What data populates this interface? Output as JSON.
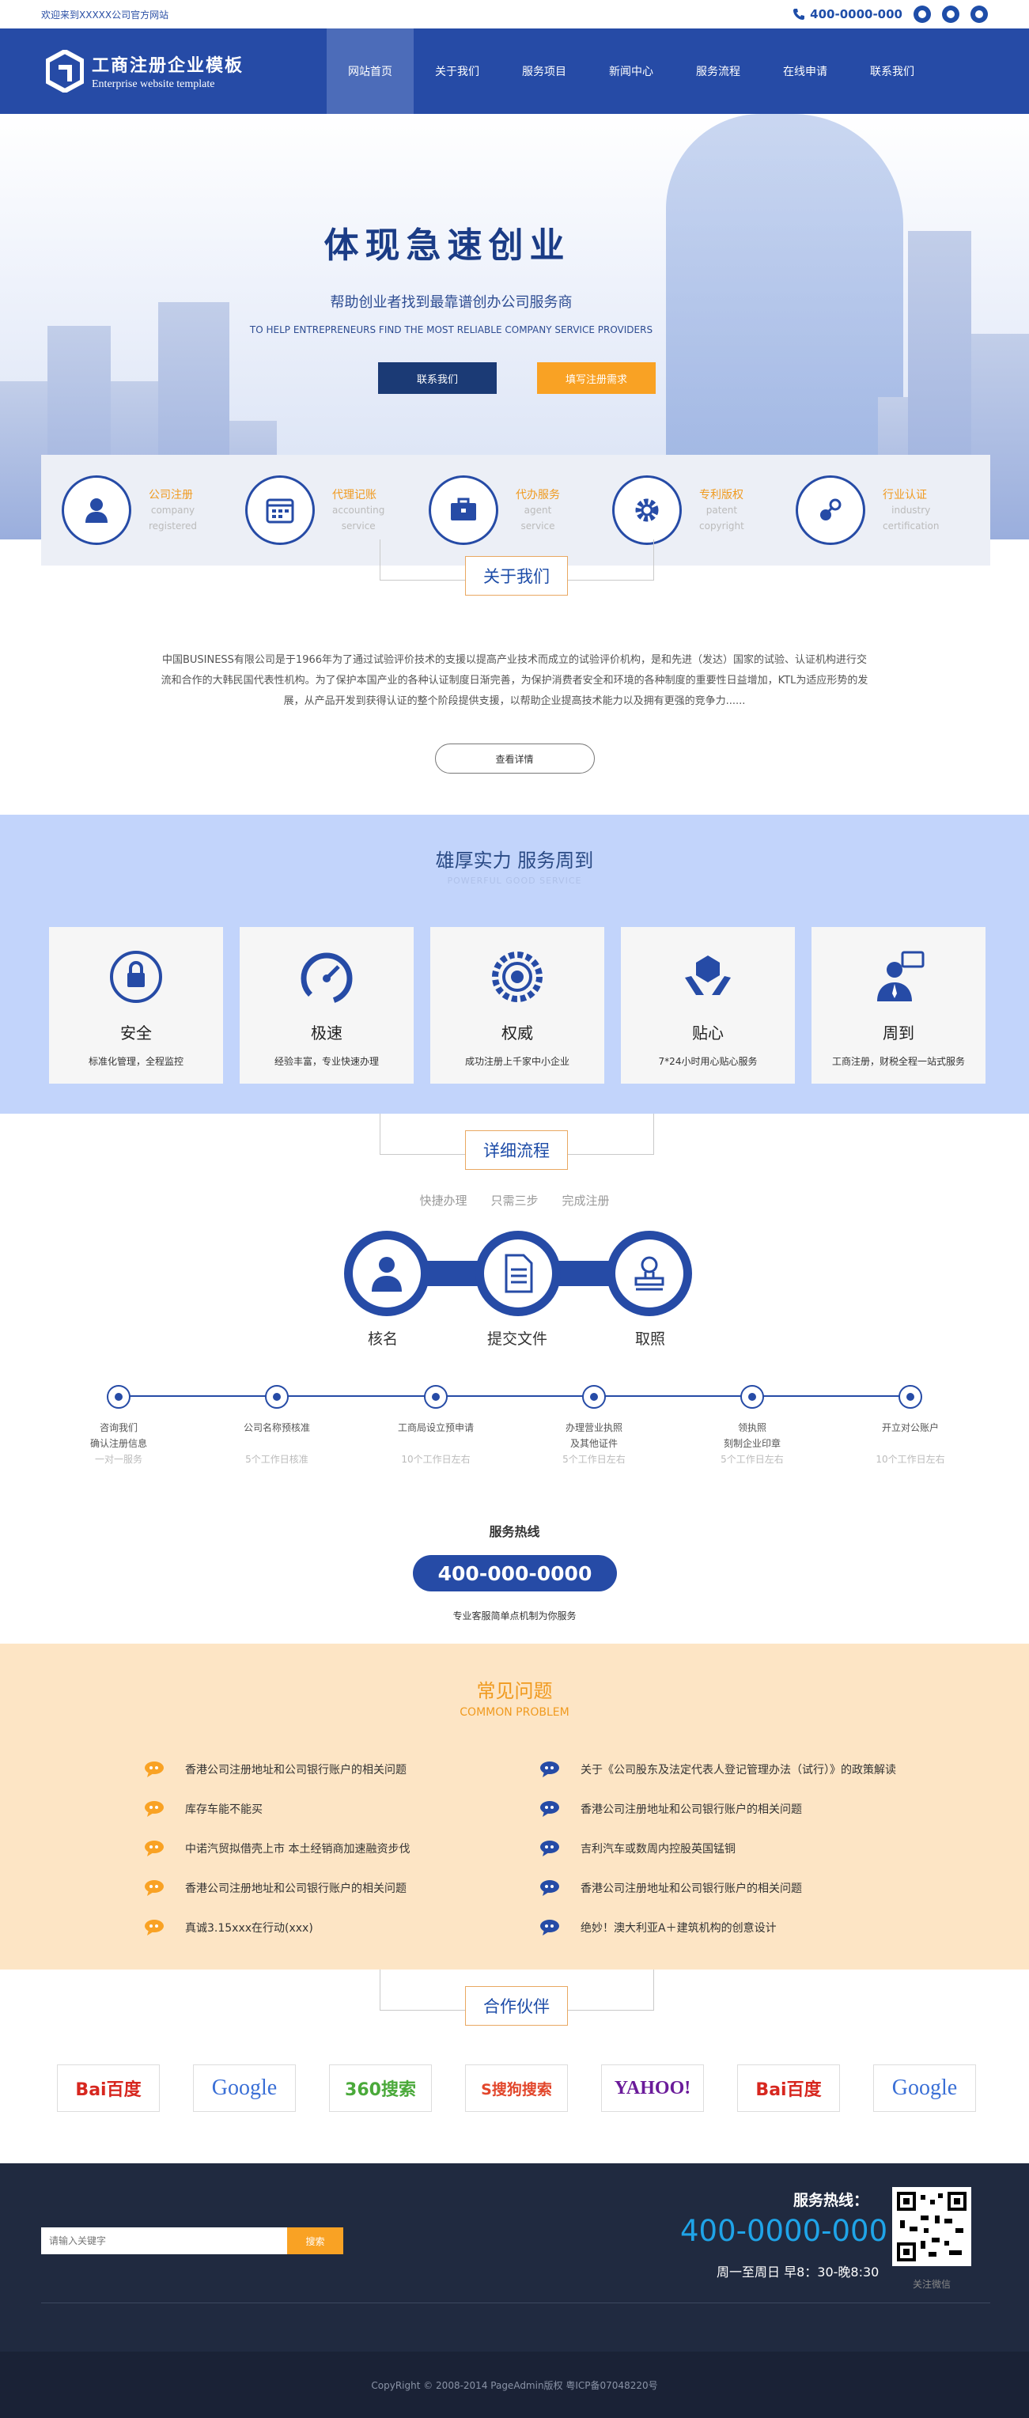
{
  "topbar": {
    "welcome": "欢迎来到XXXXX公司官方网站",
    "phone": "400-0000-000"
  },
  "header": {
    "logo_title": "工商注册企业模板",
    "logo_sub": "Enterprise website template",
    "nav": [
      "网站首页",
      "关于我们",
      "服务项目",
      "新闻中心",
      "服务流程",
      "在线申请",
      "联系我们"
    ]
  },
  "banner": {
    "title": "体现急速创业",
    "subtitle": "帮助创业者找到最靠谱创办公司服务商",
    "subtitle_en": "TO HELP ENTREPRENEURS FIND THE MOST RELIABLE COMPANY SERVICE PROVIDERS",
    "btn_contact": "联系我们",
    "btn_register": "填写注册需求"
  },
  "services": [
    {
      "name": "公司注册",
      "en1": "company",
      "en2": "registered",
      "icon": "user-icon"
    },
    {
      "name": "代理记账",
      "en1": "accounting",
      "en2": "service",
      "icon": "calendar-icon"
    },
    {
      "name": "代办服务",
      "en1": "agent",
      "en2": "service",
      "icon": "briefcase-icon"
    },
    {
      "name": "专利版权",
      "en1": "patent",
      "en2": "copyright",
      "icon": "gear-icon"
    },
    {
      "name": "行业认证",
      "en1": "industry",
      "en2": "certification",
      "icon": "link-icon"
    }
  ],
  "about": {
    "heading": "关于我们",
    "text": "中国BUSINESS有限公司是于1966年为了通过试验评价技术的支援以提高产业技术而成立的试验评价机构，是和先进（发达）国家的试验、认证机构进行交流和合作的大韩民国代表性机构。为了保护本国产业的各种认证制度日渐完善，为保护消费者安全和环境的各种制度的重要性日益增加，KTL为适应形势的发展，从产品开发到获得认证的整个阶段提供支援，以帮助企业提高技术能力以及拥有更强的竞争力......",
    "more": "查看详情"
  },
  "strength": {
    "title": "雄厚实力 服务周到",
    "subtitle": "POWERFUL GOOD SERVICE",
    "cards": [
      {
        "name": "安全",
        "desc": "标准化管理，全程监控",
        "icon": "lock-icon"
      },
      {
        "name": "极速",
        "desc": "经验丰富，专业快速办理",
        "icon": "speedometer-icon"
      },
      {
        "name": "权威",
        "desc": "成功注册上千家中小企业",
        "icon": "target-gear-icon"
      },
      {
        "name": "贴心",
        "desc": "7*24小时用心贴心服务",
        "icon": "hands-icon"
      },
      {
        "name": "周到",
        "desc": "工商注册，财税全程一站式服务",
        "icon": "agent-icon"
      }
    ]
  },
  "process": {
    "heading": "详细流程",
    "tags": [
      "快捷办理",
      "只需三步",
      "完成注册"
    ],
    "steps_main": [
      "核名",
      "提交文件",
      "取照"
    ],
    "timeline": [
      {
        "l1": "咨询我们",
        "l2": "确认注册信息",
        "t": "一对一服务"
      },
      {
        "l1": "公司名称预核准",
        "l2": "",
        "t": "5个工作日核准"
      },
      {
        "l1": "工商局设立预申请",
        "l2": "",
        "t": "10个工作日左右"
      },
      {
        "l1": "办理营业执照",
        "l2": "及其他证件",
        "t": "5个工作日左右"
      },
      {
        "l1": "领执照",
        "l2": "刻制企业印章",
        "t": "5个工作日左右"
      },
      {
        "l1": "开立对公账户",
        "l2": "",
        "t": "10个工作日左右"
      }
    ],
    "hotline_title": "服务热线",
    "hotline": "400-000-0000",
    "hotline_note": "专业客服简单点机制为你服务"
  },
  "faq": {
    "title": "常见问题",
    "subtitle": "COMMON PROBLEM",
    "left": [
      "香港公司注册地址和公司银行账户的相关问题",
      "库存车能不能买",
      "中诺汽贸拟借壳上市 本土经销商加速融资步伐",
      "香港公司注册地址和公司银行账户的相关问题",
      "真诚3.15xxx在行动(xxx)"
    ],
    "right": [
      "关于《公司股东及法定代表人登记管理办法（试行）》的政策解读",
      "香港公司注册地址和公司银行账户的相关问题",
      "吉利汽车或数周内控股英国锰铜",
      "香港公司注册地址和公司银行账户的相关问题",
      "绝妙！澳大利亚A＋建筑机构的创意设计"
    ]
  },
  "partners": {
    "heading": "合作伙伴",
    "logos": [
      {
        "text": "Bai百度",
        "color": "#d7271f"
      },
      {
        "text": "Google",
        "color": "#3a6fd6"
      },
      {
        "text": "360搜索",
        "color": "#4aa93a"
      },
      {
        "text": "S搜狗搜索",
        "color": "#e2462b"
      },
      {
        "text": "YAHOO!",
        "color": "#6b1b9a"
      },
      {
        "text": "Bai百度",
        "color": "#d7271f"
      },
      {
        "text": "Google",
        "color": "#3a6fd6"
      }
    ]
  },
  "footer": {
    "search_placeholder": "请输入关键字",
    "search_btn": "搜索",
    "hotline_label": "服务热线：",
    "hotline": "400-0000-000",
    "hours": "周一至周日 早8：30-晚8:30",
    "qr_caption": "关注微信",
    "copyright": "CopyRight © 2008-2014 PageAdmin版权 粤ICP备07048220号"
  },
  "colors": {
    "primary": "#264ba6",
    "accent": "#f9a224",
    "faq_bg": "#fde5c5",
    "strength_bg": "#c2d4fb",
    "footer_bg": "#202a40"
  }
}
